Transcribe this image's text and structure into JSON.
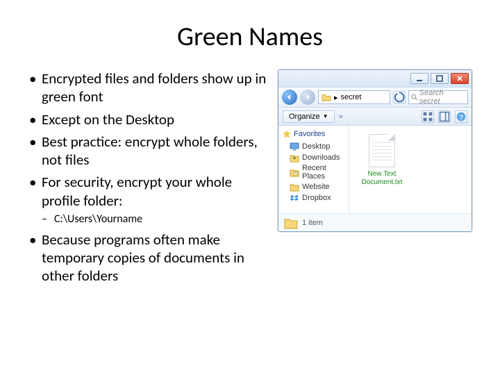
{
  "title": "Green Names",
  "bullets": [
    "Encrypted files and folders show up in green font",
    "Except on the Desktop",
    "Best practice: encrypt whole folders, not files",
    "For security, encrypt your whole profile folder:"
  ],
  "sub_bullet": "C:\\Users\\Yourname",
  "bullet_after": "Because programs often make temporary copies of documents in other folders",
  "explorer": {
    "path_segment": "secret",
    "organize": "Organize",
    "chev": "»",
    "search_placeholder": "Search secret",
    "favorites_header": "Favorites",
    "favorites": [
      "Desktop",
      "Downloads",
      "Recent Places",
      "Website",
      "Dropbox"
    ],
    "file_name": "New Text Document.txt",
    "status": "1 item"
  }
}
